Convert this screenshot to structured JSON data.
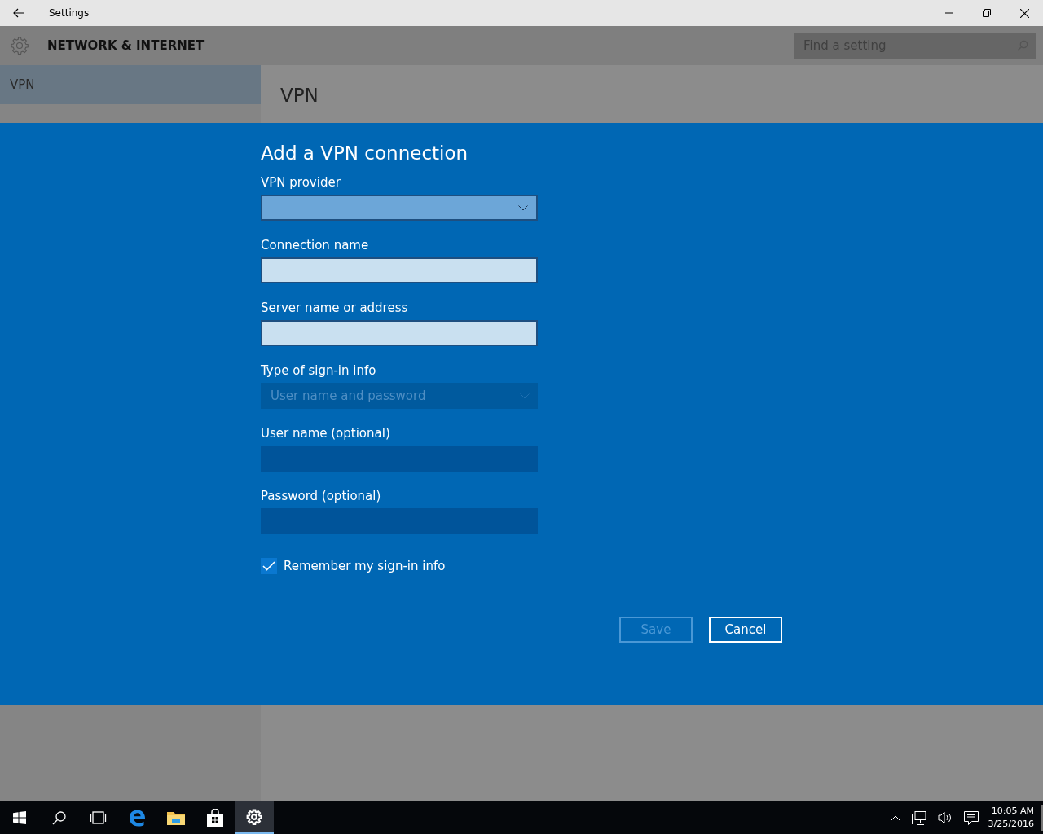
{
  "window": {
    "title": "Settings"
  },
  "header": {
    "title": "NETWORK & INTERNET",
    "search": {
      "placeholder": "Find a setting"
    }
  },
  "sidebar": {
    "items": [
      {
        "label": "VPN",
        "selected": true
      }
    ]
  },
  "page": {
    "title": "VPN"
  },
  "dialog": {
    "title": "Add a VPN connection",
    "fields": [
      {
        "kind": "dropdown",
        "label": "VPN provider",
        "disabled": false
      },
      {
        "kind": "text",
        "label": "Connection name",
        "disabled": false
      },
      {
        "kind": "text",
        "label": "Server name or address",
        "disabled": false
      },
      {
        "kind": "dropdown",
        "label": "Type of sign-in info",
        "value": "User name and password",
        "disabled": true
      },
      {
        "kind": "text",
        "label": "User name (optional)",
        "disabled": true
      },
      {
        "kind": "text",
        "label": "Password (optional)",
        "disabled": true
      }
    ],
    "checkbox": {
      "label": "Remember my sign-in info",
      "checked": true
    },
    "buttons": [
      {
        "label": "Save",
        "disabled": true
      },
      {
        "label": "Cancel",
        "disabled": false
      }
    ]
  },
  "taskbar": {
    "apps": [
      {
        "kind": "start",
        "active": false
      },
      {
        "kind": "search",
        "active": false
      },
      {
        "kind": "taskview",
        "active": false
      },
      {
        "kind": "browser",
        "active": false
      },
      {
        "kind": "folder",
        "active": false
      },
      {
        "kind": "store",
        "active": false
      },
      {
        "kind": "settings",
        "active": true
      }
    ],
    "clock": {
      "time": "10:05 AM",
      "date": "3/25/2016"
    }
  }
}
